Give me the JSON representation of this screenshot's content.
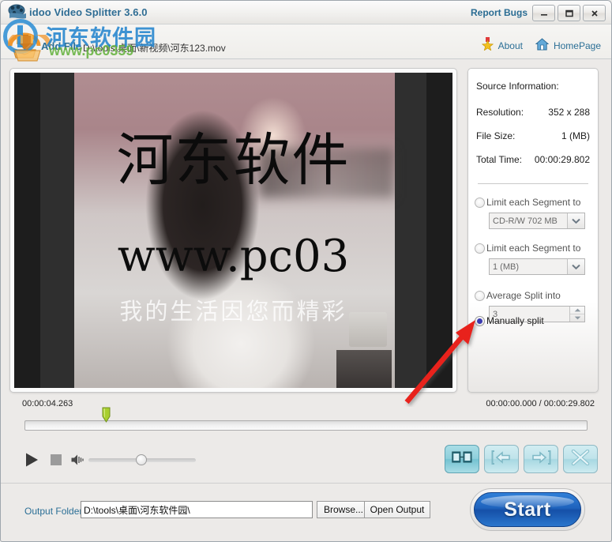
{
  "window": {
    "title": "idoo Video Splitter 3.6.0",
    "report_bugs": "Report Bugs",
    "minimize_icon": "minimize-icon",
    "maximize_icon": "maximize-icon",
    "close_icon": "close-icon"
  },
  "toolbar": {
    "add_file_label": "Add File",
    "file_path": "D:\\tools\\桌面\\新视频\\河东123.mov",
    "about_label": "About",
    "homepage_label": "HomePage",
    "about_icon": "star-medal-icon",
    "homepage_icon": "home-icon",
    "add_file_icon": "add-file-download-icon"
  },
  "preview": {
    "watermark_cn": "河东软件",
    "watermark_url": "www.pc03",
    "watermark_slogan": "我的生活因您而精彩"
  },
  "source_info": {
    "heading": "Source Information:",
    "rows": [
      {
        "key": "Resolution:",
        "value": "352 x 288"
      },
      {
        "key": "File Size:",
        "value": "1 (MB)"
      },
      {
        "key": "Total Time:",
        "value": "00:00:29.802"
      }
    ]
  },
  "split_options": [
    {
      "label": "Limit each Segment to",
      "selected": false,
      "control": "combo",
      "value": "CD-R/W 702 MB"
    },
    {
      "label": "Limit each Segment to",
      "selected": false,
      "control": "combo",
      "value": "1 (MB)"
    },
    {
      "label": "Average Split into",
      "selected": false,
      "control": "spinner",
      "value": "3"
    },
    {
      "label": "Manually split",
      "selected": true,
      "control": "none",
      "value": ""
    }
  ],
  "timeline": {
    "current_time": "00:00:04.263",
    "range_time": "00:00:00.000 / 00:00:29.802",
    "marker_position_percent": 14,
    "progress_percent": 0
  },
  "transport": {
    "play_icon": "play-icon",
    "stop_icon": "stop-icon",
    "volume_icon": "speaker-icon",
    "volume_percent": 45
  },
  "actions": [
    {
      "name": "split-segment-button",
      "icon": "split-frames-icon",
      "active": true
    },
    {
      "name": "set-start-marker-button",
      "icon": "arrow-to-start-icon",
      "active": false
    },
    {
      "name": "set-end-marker-button",
      "icon": "arrow-to-end-icon",
      "active": false
    },
    {
      "name": "delete-segment-button",
      "icon": "x-cross-icon",
      "active": false
    }
  ],
  "output": {
    "label": "Output Folder:",
    "path": "D:\\tools\\桌面\\河东软件园\\",
    "browse_label": "Browse...",
    "open_output_label": "Open Output"
  },
  "start": {
    "label": "Start"
  },
  "overlay_watermark": {
    "text_cn": "河东软件园",
    "text_url": "www.pc0359",
    "color_blue": "#2384cd",
    "color_green": "#60b03a"
  },
  "annotation": {
    "arrow_color": "#e8211a",
    "arrow_name": "red-pointer-arrow"
  },
  "colors": {
    "accent_blue": "#2b6f96",
    "start_button": "#1f63bd",
    "action_button": "#bfe3ea",
    "marker_green": "#93c020"
  }
}
